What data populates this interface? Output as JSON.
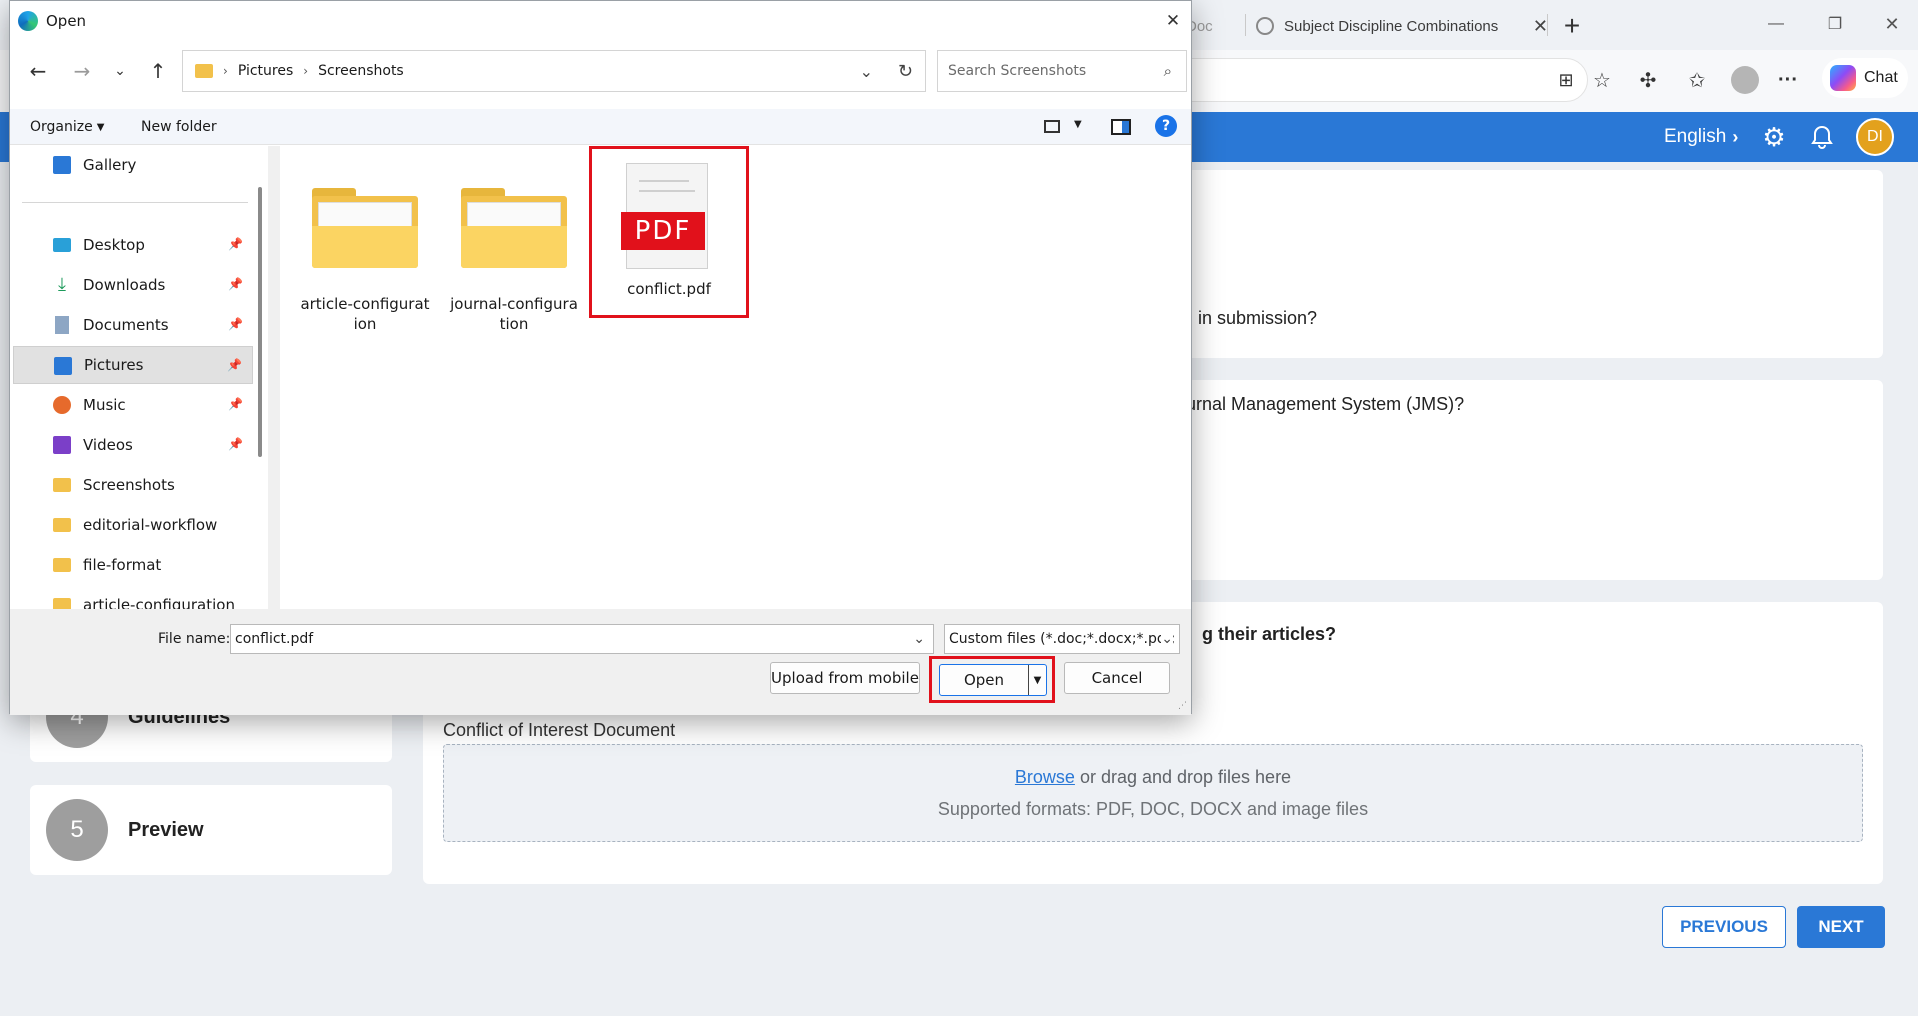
{
  "browser": {
    "tabs": [
      {
        "label": "Doc",
        "partial": true
      },
      {
        "label": "Subject Discipline Combinations"
      }
    ],
    "new_tab_symbol": "+",
    "chat_label": "Chat"
  },
  "appbar": {
    "language": "English",
    "avatar_initials": "DI"
  },
  "page": {
    "questions": [
      {
        "text": "in submission?",
        "partial": true
      },
      {
        "text": "urnal Management System (JMS)?",
        "partial": true
      },
      {
        "text": "g their articles?",
        "partial": true
      }
    ],
    "steps": [
      {
        "number": "4",
        "label": "Guidelines"
      },
      {
        "number": "5",
        "label": "Preview"
      }
    ],
    "upload": {
      "label": "Conflict of Interest Document",
      "browse_link": "Browse",
      "drop_text": " or drag and drop files here",
      "formats_text": "Supported formats: PDF, DOC, DOCX and image files"
    },
    "buttons": {
      "previous": "PREVIOUS",
      "next": "NEXT"
    },
    "colors": {
      "brand_blue": "#2a78d6",
      "highlight_red": "#e1111b",
      "folder_yellow": "#f2c14b"
    }
  },
  "dialog": {
    "title": "Open",
    "breadcrumb": [
      "Pictures",
      "Screenshots"
    ],
    "search_placeholder": "Search Screenshots",
    "toolbar": {
      "organize": "Organize",
      "new_folder": "New folder"
    },
    "nav": [
      {
        "label": "Gallery",
        "icon": "gallery-icon",
        "pinned": false
      },
      {
        "label": "Desktop",
        "icon": "desktop-icon",
        "pinned": true
      },
      {
        "label": "Downloads",
        "icon": "download-icon",
        "pinned": true
      },
      {
        "label": "Documents",
        "icon": "documents-icon",
        "pinned": true
      },
      {
        "label": "Pictures",
        "icon": "pictures-icon",
        "pinned": true,
        "selected": true
      },
      {
        "label": "Music",
        "icon": "music-icon",
        "pinned": true
      },
      {
        "label": "Videos",
        "icon": "videos-icon",
        "pinned": true
      },
      {
        "label": "Screenshots",
        "icon": "folder-icon",
        "pinned": false
      },
      {
        "label": "editorial-workflow",
        "icon": "folder-icon",
        "pinned": false
      },
      {
        "label": "file-format",
        "icon": "folder-icon",
        "pinned": false
      },
      {
        "label": "article-configuration",
        "icon": "folder-icon",
        "pinned": false
      }
    ],
    "items": [
      {
        "label_line1": "article-configurat",
        "label_line2": "ion",
        "type": "folder"
      },
      {
        "label_line1": "journal-configura",
        "label_line2": "tion",
        "type": "folder"
      },
      {
        "label_line1": "conflict.pdf",
        "label_line2": "",
        "type": "pdf",
        "badge": "PDF"
      }
    ],
    "file_name_label": "File name:",
    "file_name_value": "conflict.pdf",
    "file_type_value": "Custom files (*.doc;*.docx;*.pdf;",
    "upload_mobile": "Upload from mobile",
    "open_button": "Open",
    "cancel_button": "Cancel"
  }
}
